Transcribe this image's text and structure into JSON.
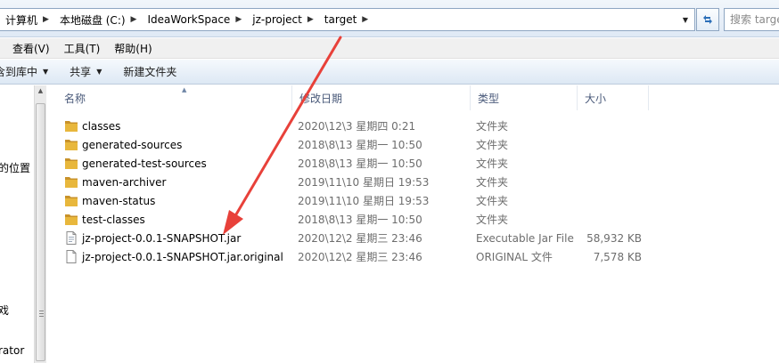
{
  "address_bar": {
    "segments": [
      "计算机",
      "本地磁盘 (C:)",
      "IdeaWorkSpace",
      "jz-project",
      "target"
    ],
    "search_placeholder": "搜索 target"
  },
  "menu": {
    "items": [
      "查看(V)",
      "工具(T)",
      "帮助(H)"
    ]
  },
  "toolbar": {
    "include_library": "含到库中",
    "share": "共享",
    "new_folder": "新建文件夹"
  },
  "nav": {
    "items": [
      "的位置",
      "戏",
      "rator"
    ]
  },
  "columns": {
    "name": "名称",
    "date": "修改日期",
    "type": "类型",
    "size": "大小"
  },
  "files": [
    {
      "name": "classes",
      "date": "2020\\12\\3 星期四 0:21",
      "type": "文件夹",
      "size": "",
      "icon": "folder-icon"
    },
    {
      "name": "generated-sources",
      "date": "2018\\8\\13 星期一 10:50",
      "type": "文件夹",
      "size": "",
      "icon": "folder-icon"
    },
    {
      "name": "generated-test-sources",
      "date": "2018\\8\\13 星期一 10:50",
      "type": "文件夹",
      "size": "",
      "icon": "folder-icon"
    },
    {
      "name": "maven-archiver",
      "date": "2019\\11\\10 星期日 19:53",
      "type": "文件夹",
      "size": "",
      "icon": "folder-icon"
    },
    {
      "name": "maven-status",
      "date": "2019\\11\\10 星期日 19:53",
      "type": "文件夹",
      "size": "",
      "icon": "folder-icon"
    },
    {
      "name": "test-classes",
      "date": "2018\\8\\13 星期一 10:50",
      "type": "文件夹",
      "size": "",
      "icon": "folder-icon"
    },
    {
      "name": "jz-project-0.0.1-SNAPSHOT.jar",
      "date": "2020\\12\\2 星期三 23:46",
      "type": "Executable Jar File",
      "size": "58,932 KB",
      "icon": "jar-file-icon"
    },
    {
      "name": "jz-project-0.0.1-SNAPSHOT.jar.original",
      "date": "2020\\12\\2 星期三 23:46",
      "type": "ORIGINAL 文件",
      "size": "7,578 KB",
      "icon": "blank-file-icon"
    }
  ],
  "colors": {
    "folder": "#e8b73c",
    "folder_dark": "#c8922a",
    "annotation_arrow": "#e8413a",
    "header_text": "#4a5a7a"
  }
}
